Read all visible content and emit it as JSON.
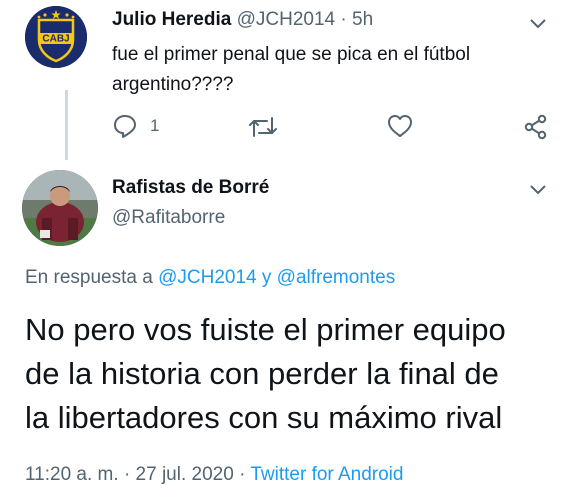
{
  "parent_tweet": {
    "author_name": "Julio Heredia",
    "author_handle": "@JCH2014",
    "separator": "·",
    "time": "5h",
    "avatar_text": "CABJ",
    "text_line1": "fue el primer penal que se pica en el fútbol",
    "text_line2": "argentino????",
    "reply_count": "1"
  },
  "main_tweet": {
    "author_name": "Rafistas de Borré",
    "author_handle": "@Rafitaborre",
    "reply_prefix": "En respuesta a",
    "reply_to_1": "@JCH2014",
    "reply_and": "y",
    "reply_to_2": "@alfremontes",
    "text_line1": "No pero vos fuiste el primer equipo",
    "text_line2": "de la historia con perder la final de",
    "text_line3": "la libertadores con su máximo rival",
    "time": "11:20 a. m.",
    "dot1": "·",
    "date": "27 jul. 2020",
    "dot2": "·",
    "source": "Twitter for Android"
  },
  "colors": {
    "accent": "#1d9bf0",
    "muted": "#536471",
    "text": "#0f1419",
    "boca_blue": "#1a2c6b",
    "boca_yellow": "#f5c518"
  },
  "icons": [
    "boca-crest-icon",
    "chevron-down-icon",
    "reply-icon",
    "retweet-icon",
    "like-icon",
    "share-icon"
  ]
}
